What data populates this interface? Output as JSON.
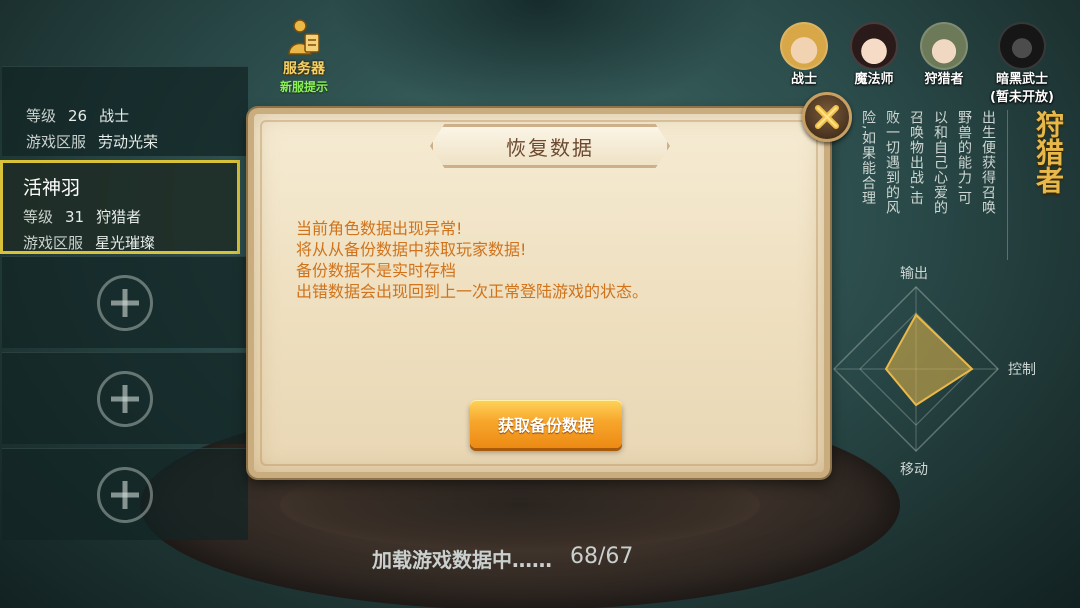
{
  "server": {
    "title": "服务器",
    "subtitle": "新服提示",
    "icon": "server-person-icon"
  },
  "classes": [
    {
      "name": "战士",
      "icon": "warrior-portrait"
    },
    {
      "name": "魔法师",
      "icon": "mage-portrait"
    },
    {
      "name": "狩猎者",
      "icon": "hunter-portrait"
    },
    {
      "name": "暗黑武士",
      "sub": "(暂未开放)",
      "icon": "dark-knight-portrait"
    }
  ],
  "slots": {
    "first": {
      "level_label": "等级",
      "level": "26",
      "class": "战士",
      "zone_label": "游戏区服",
      "zone": "劳动光荣"
    },
    "selected": {
      "name": "活神羽",
      "level_label": "等级",
      "level": "31",
      "class": "狩猎者",
      "zone_label": "游戏区服",
      "zone": "星光璀璨"
    },
    "empty_icon": "plus-icon"
  },
  "class_info": {
    "title": "狩猎者",
    "description_columns": [
      "出生便获得召唤",
      "野兽的能力,可",
      "以和自己心爱的",
      "召唤物出战,击",
      "败一切遇到的风",
      "险,如果能合理"
    ]
  },
  "radar": {
    "labels": {
      "top": "输出",
      "right": "控制",
      "bottom": "移动"
    }
  },
  "dialog": {
    "title": "恢复数据",
    "lines": [
      "当前角色数据出现异常!",
      "将从从备份数据中获取玩家数据!",
      "备份数据不是实时存档",
      "出错数据会出现回到上一次正常登陆游戏的状态。"
    ],
    "button_label": "获取备份数据",
    "close_icon": "close-x-icon"
  },
  "loading": {
    "text": "加载游戏数据中……",
    "progress": "68/67"
  },
  "colors": {
    "accent_gold": "#e8b84a",
    "dialog_text": "#d0731c",
    "button_orange": "#f7a62b",
    "selection_border": "#d8c23a"
  }
}
